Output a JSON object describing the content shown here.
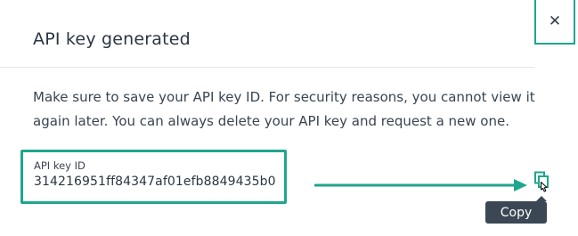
{
  "modal": {
    "title": "API key generated",
    "close_icon": "close-icon",
    "message": "Make sure to save your API key ID. For security reasons, you cannot view it again later. You can always delete your API key and request a new one."
  },
  "api_key": {
    "label": "API key ID",
    "value": "314216951ff84347af01efb8849435b0"
  },
  "copy": {
    "icon": "copy-icon",
    "tooltip": "Copy"
  },
  "colors": {
    "highlight": "#1fa68e",
    "tooltip_bg": "#3b4755"
  }
}
